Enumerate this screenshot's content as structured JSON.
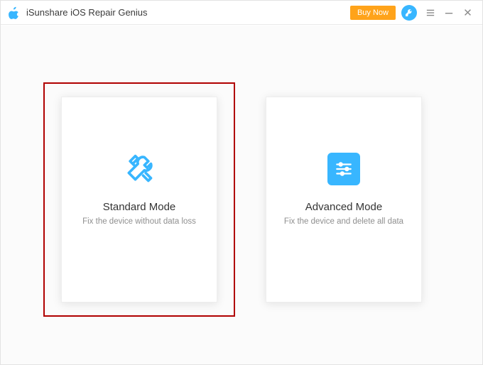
{
  "app": {
    "title": "iSunshare iOS Repair Genius"
  },
  "titlebar": {
    "buy_now": "Buy Now"
  },
  "modes": {
    "standard": {
      "title": "Standard Mode",
      "subtitle": "Fix the device without data loss"
    },
    "advanced": {
      "title": "Advanced Mode",
      "subtitle": "Fix the device and delete all data"
    }
  },
  "colors": {
    "accent": "#38b6ff",
    "buy_bg": "#ffa31a",
    "highlight": "#b00000"
  }
}
